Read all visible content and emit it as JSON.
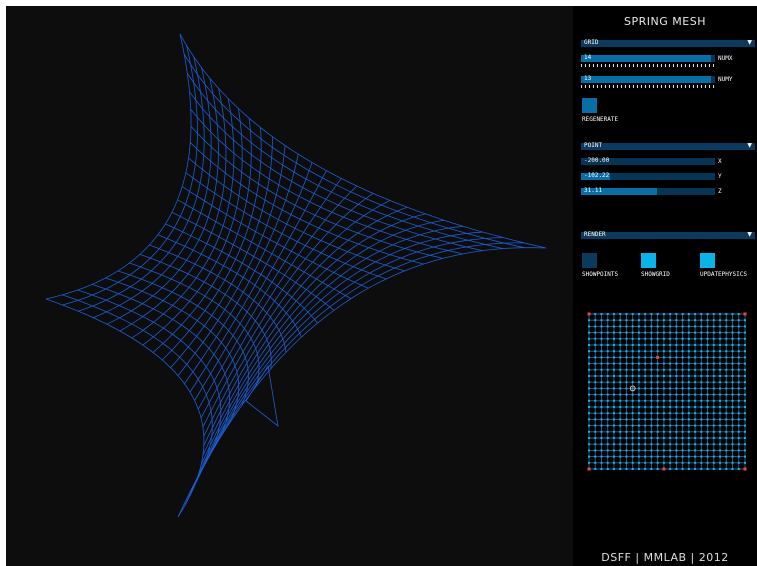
{
  "app": {
    "title": "SPRING MESH",
    "footer": "DSFF | MMLAB | 2012"
  },
  "colors": {
    "background": "#0d0d0d",
    "panel": "#000000",
    "mesh": "#1e5cd0",
    "accent": "#0ab4e8",
    "slider_track": "#073556",
    "slider_fill": "#0a6ea6",
    "fixed_point": "#ff3b3b"
  },
  "groups": {
    "grid": {
      "label": "GRID",
      "numx": {
        "value": "14",
        "label": "NUMX",
        "fraction": 0.97
      },
      "numy": {
        "value": "13",
        "label": "NUMY",
        "fraction": 0.97
      },
      "regenerate_label": "REGENERATE"
    },
    "point": {
      "label": "POINT",
      "x": {
        "value": "-200.00",
        "label": "X",
        "fraction": 0.0
      },
      "y": {
        "value": "-102.22",
        "label": "Y",
        "fraction": 0.22
      },
      "z": {
        "value": "31.11",
        "label": "Z",
        "fraction": 0.57
      }
    },
    "render": {
      "label": "RENDER",
      "toggles": [
        {
          "label": "SHOWPOINTS",
          "on": false
        },
        {
          "label": "SHOWGRID",
          "on": true
        },
        {
          "label": "UPDATEPHYSICS",
          "on": true
        }
      ]
    }
  }
}
